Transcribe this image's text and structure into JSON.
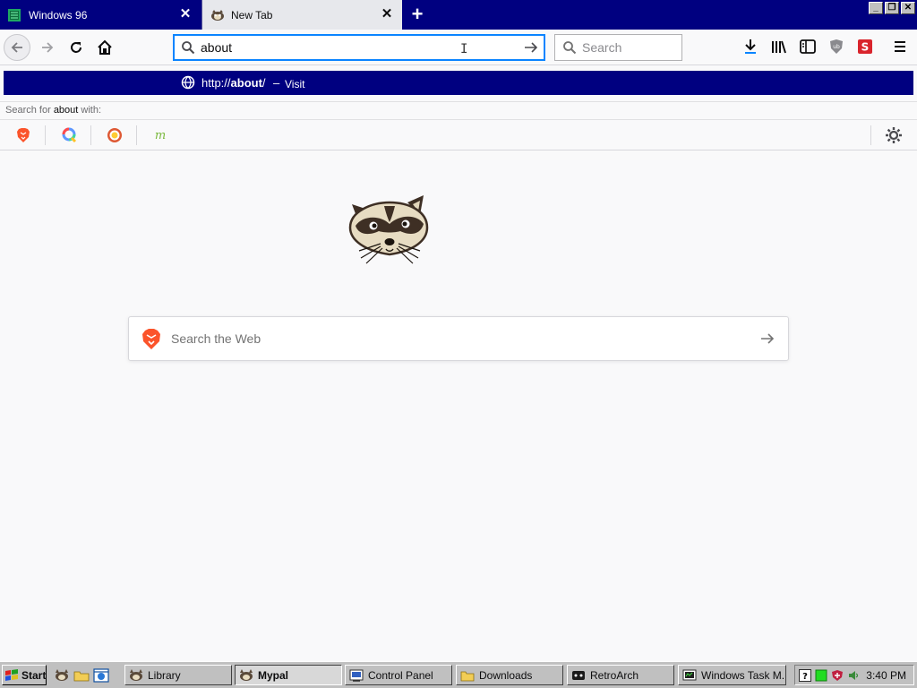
{
  "tabs": [
    {
      "title": "Windows 96",
      "icon": "windows96-icon",
      "active": false
    },
    {
      "title": "New Tab",
      "icon": "raccoon-icon",
      "active": true
    }
  ],
  "window_controls": {
    "minimize": "_",
    "restore": "❐",
    "close": "✕"
  },
  "urlbar": {
    "value": "about"
  },
  "searchbar": {
    "placeholder": "Search"
  },
  "autocomplete": {
    "url_prefix": "http://",
    "url_bold": "about",
    "url_suffix": "/",
    "separator": "–",
    "action": "Visit",
    "search_for_prefix": "Search for ",
    "search_for_term": "about",
    "search_for_suffix": " with:",
    "engines": [
      "brave-search",
      "qwant",
      "duckduckgo",
      "mojeek"
    ]
  },
  "page": {
    "search_placeholder": "Search the Web"
  },
  "taskbar": {
    "start_label": "Start",
    "buttons": [
      {
        "label": "Library",
        "icon": "raccoon-icon",
        "active": false
      },
      {
        "label": "Mypal",
        "icon": "raccoon-icon",
        "active": true
      },
      {
        "label": "Control Panel",
        "icon": "control-panel-icon",
        "active": false
      },
      {
        "label": "Downloads",
        "icon": "folder-icon",
        "active": false
      },
      {
        "label": "RetroArch",
        "icon": "retroarch-icon",
        "active": false
      },
      {
        "label": "Windows Task M...",
        "icon": "task-manager-icon",
        "active": false
      }
    ],
    "clock": "3:40 PM"
  },
  "colors": {
    "titlebar": "#000080",
    "focus": "#0a84ff",
    "brave": "#fb542b",
    "page_bg": "#f9f9fa"
  }
}
